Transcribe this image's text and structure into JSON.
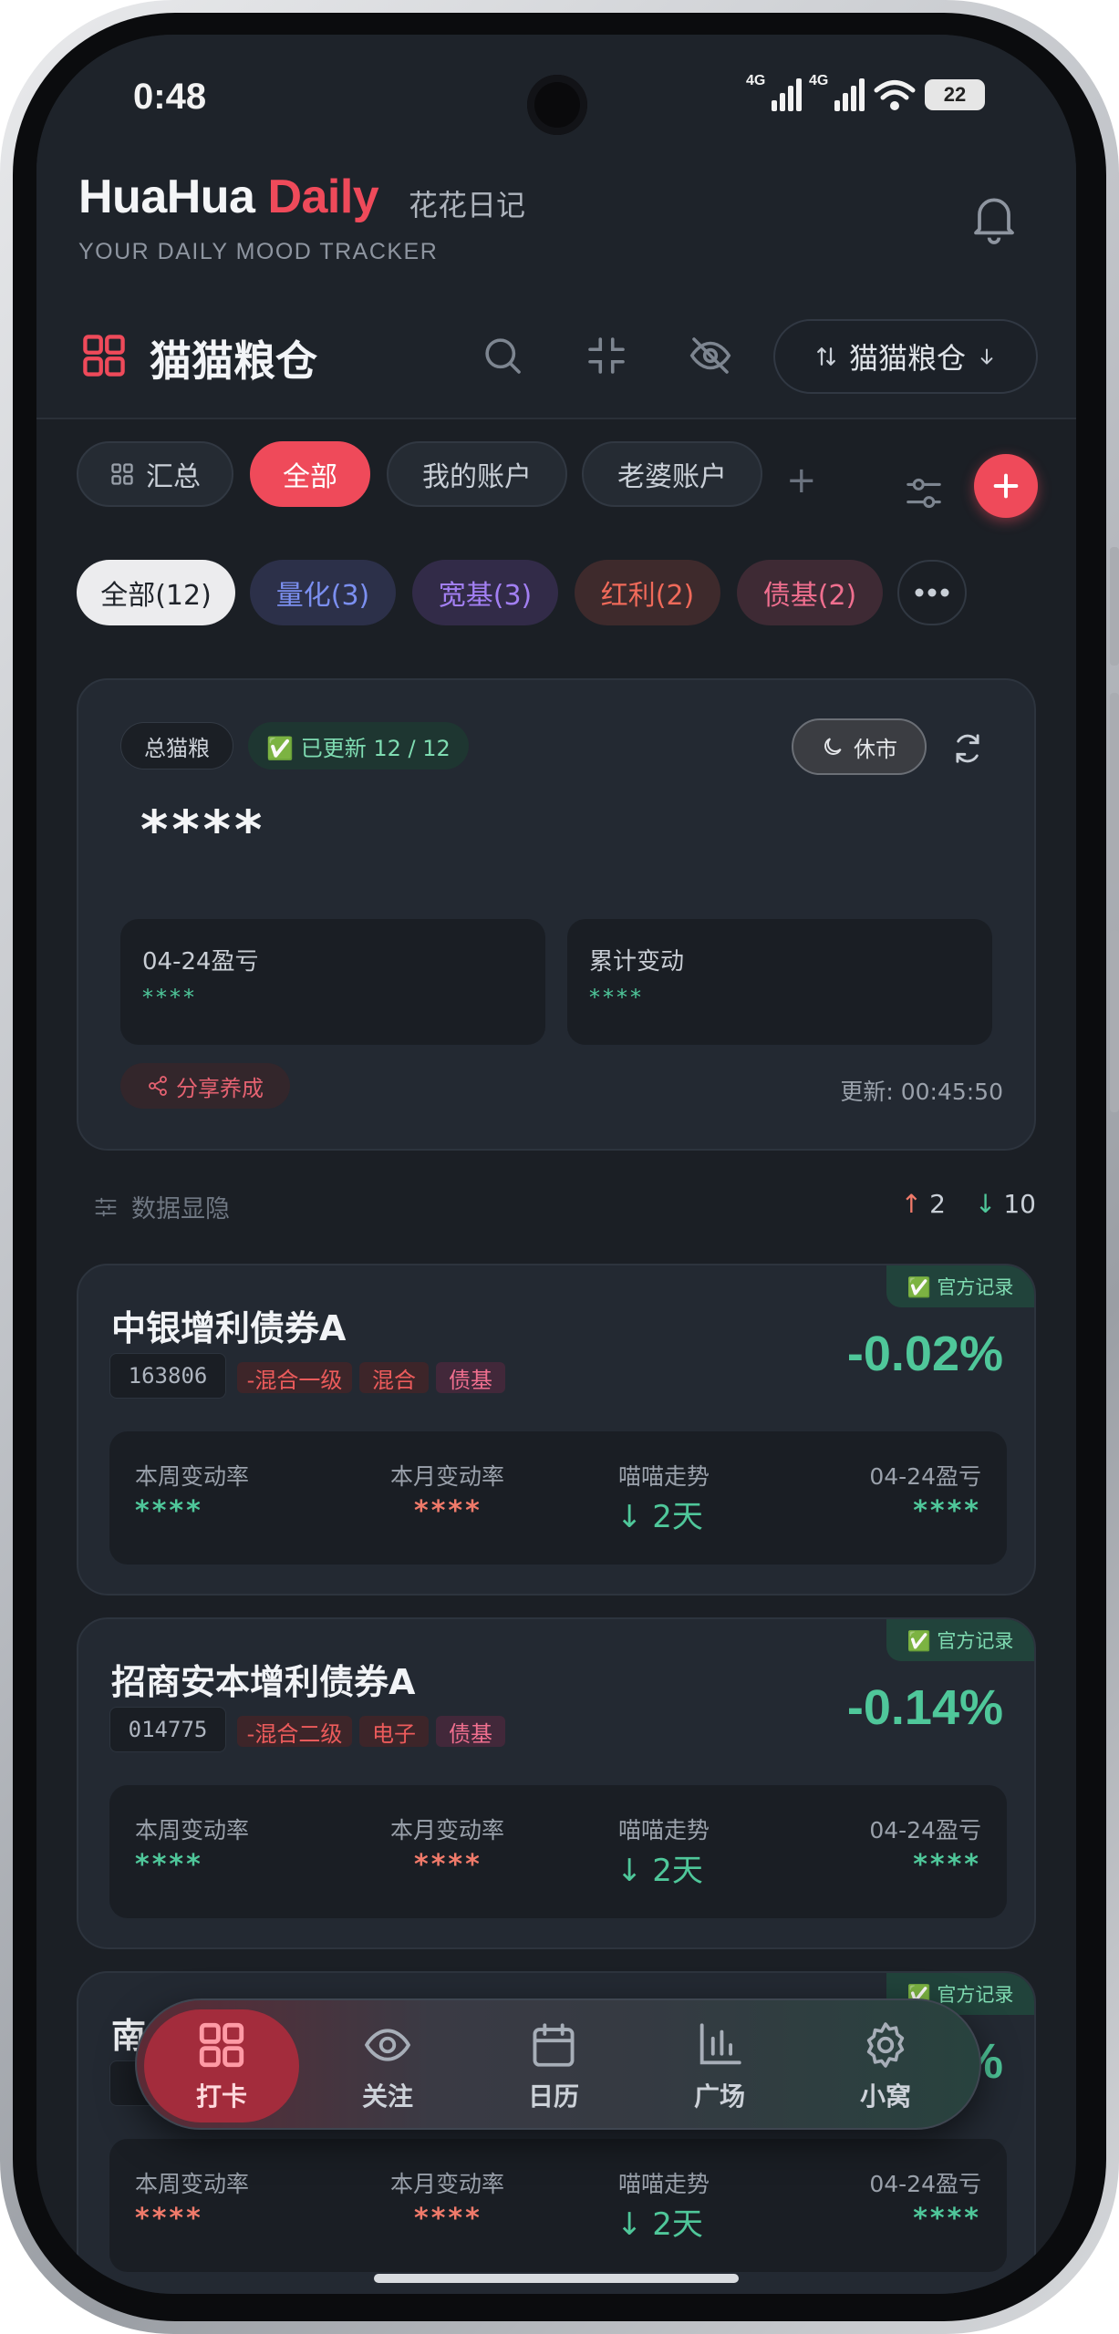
{
  "status_bar": {
    "time": "0:48",
    "signal1": "4G",
    "signal2": "4G",
    "battery": "22"
  },
  "header": {
    "brand_primary": "HuaHua",
    "brand_accent": "Daily",
    "brand_cn": "花花日记",
    "tagline": "YOUR DAILY MOOD TRACKER"
  },
  "vault": {
    "title": "猫猫粮仓",
    "sort_label": "猫猫粮仓"
  },
  "account_tabs": {
    "summary": "汇总",
    "items": [
      "全部",
      "我的账户",
      "老婆账户"
    ],
    "add": "+"
  },
  "categories": [
    {
      "label": "全部(12)",
      "color": "#1f232a",
      "bg": "#ececee"
    },
    {
      "label": "量化(3)",
      "color": "#7b8ff0",
      "bg": "#2c3049"
    },
    {
      "label": "宽基(3)",
      "color": "#a27ff2",
      "bg": "#322b48"
    },
    {
      "label": "红利(2)",
      "color": "#f06a5a",
      "bg": "#3e2a2c"
    },
    {
      "label": "债基(2)",
      "color": "#f06f8f",
      "bg": "#3e2a34"
    }
  ],
  "summary": {
    "badge": "总猫粮",
    "updated": "✅ 已更新 12 / 12",
    "market_status": "休市",
    "total": "****",
    "daily_label": "04-24盈亏",
    "daily_value": "****",
    "cumulative_label": "累计变动",
    "cumulative_value": "****",
    "share": "分享养成",
    "update_time": "更新: 00:45:50"
  },
  "list_header": {
    "toggle": "数据显隐",
    "up_count": "2",
    "down_count": "10"
  },
  "funds": [
    {
      "name": "中银增利债券A",
      "code": "163806",
      "tags": [
        "-混合一级",
        "混合",
        "债基"
      ],
      "official": "✅ 官方记录",
      "change": "-0.02%",
      "weekly_label": "本周变动率",
      "weekly": "****",
      "monthly_label": "本月变动率",
      "monthly": "****",
      "trend_label": "喵喵走势",
      "trend": "↓  2天",
      "pnl_label": "04-24盈亏",
      "pnl": "****"
    },
    {
      "name": "招商安本增利债券A",
      "code": "014775",
      "tags": [
        "-混合二级",
        "电子",
        "债基"
      ],
      "official": "✅ 官方记录",
      "change": "-0.14%",
      "weekly_label": "本周变动率",
      "weekly": "****",
      "monthly_label": "本月变动率",
      "monthly": "****",
      "trend_label": "喵喵走势",
      "trend": "↓  2天",
      "pnl_label": "04-24盈亏",
      "pnl": "****"
    },
    {
      "name": "南",
      "code": "0",
      "official": "✅ 官方记录",
      "change": "%",
      "weekly_label": "本周变动率",
      "weekly": "****",
      "monthly_label": "本月变动率",
      "monthly": "****",
      "trend_label": "喵喵走势",
      "trend": "↓  2天",
      "pnl_label": "04-24盈亏",
      "pnl": "****"
    }
  ],
  "nav": [
    "打卡",
    "关注",
    "日历",
    "广场",
    "小窝"
  ],
  "colors": {
    "accent": "#ef4a5a",
    "down": "#4fc79a",
    "up": "#f07a6a",
    "bg": "#1b1f25"
  }
}
